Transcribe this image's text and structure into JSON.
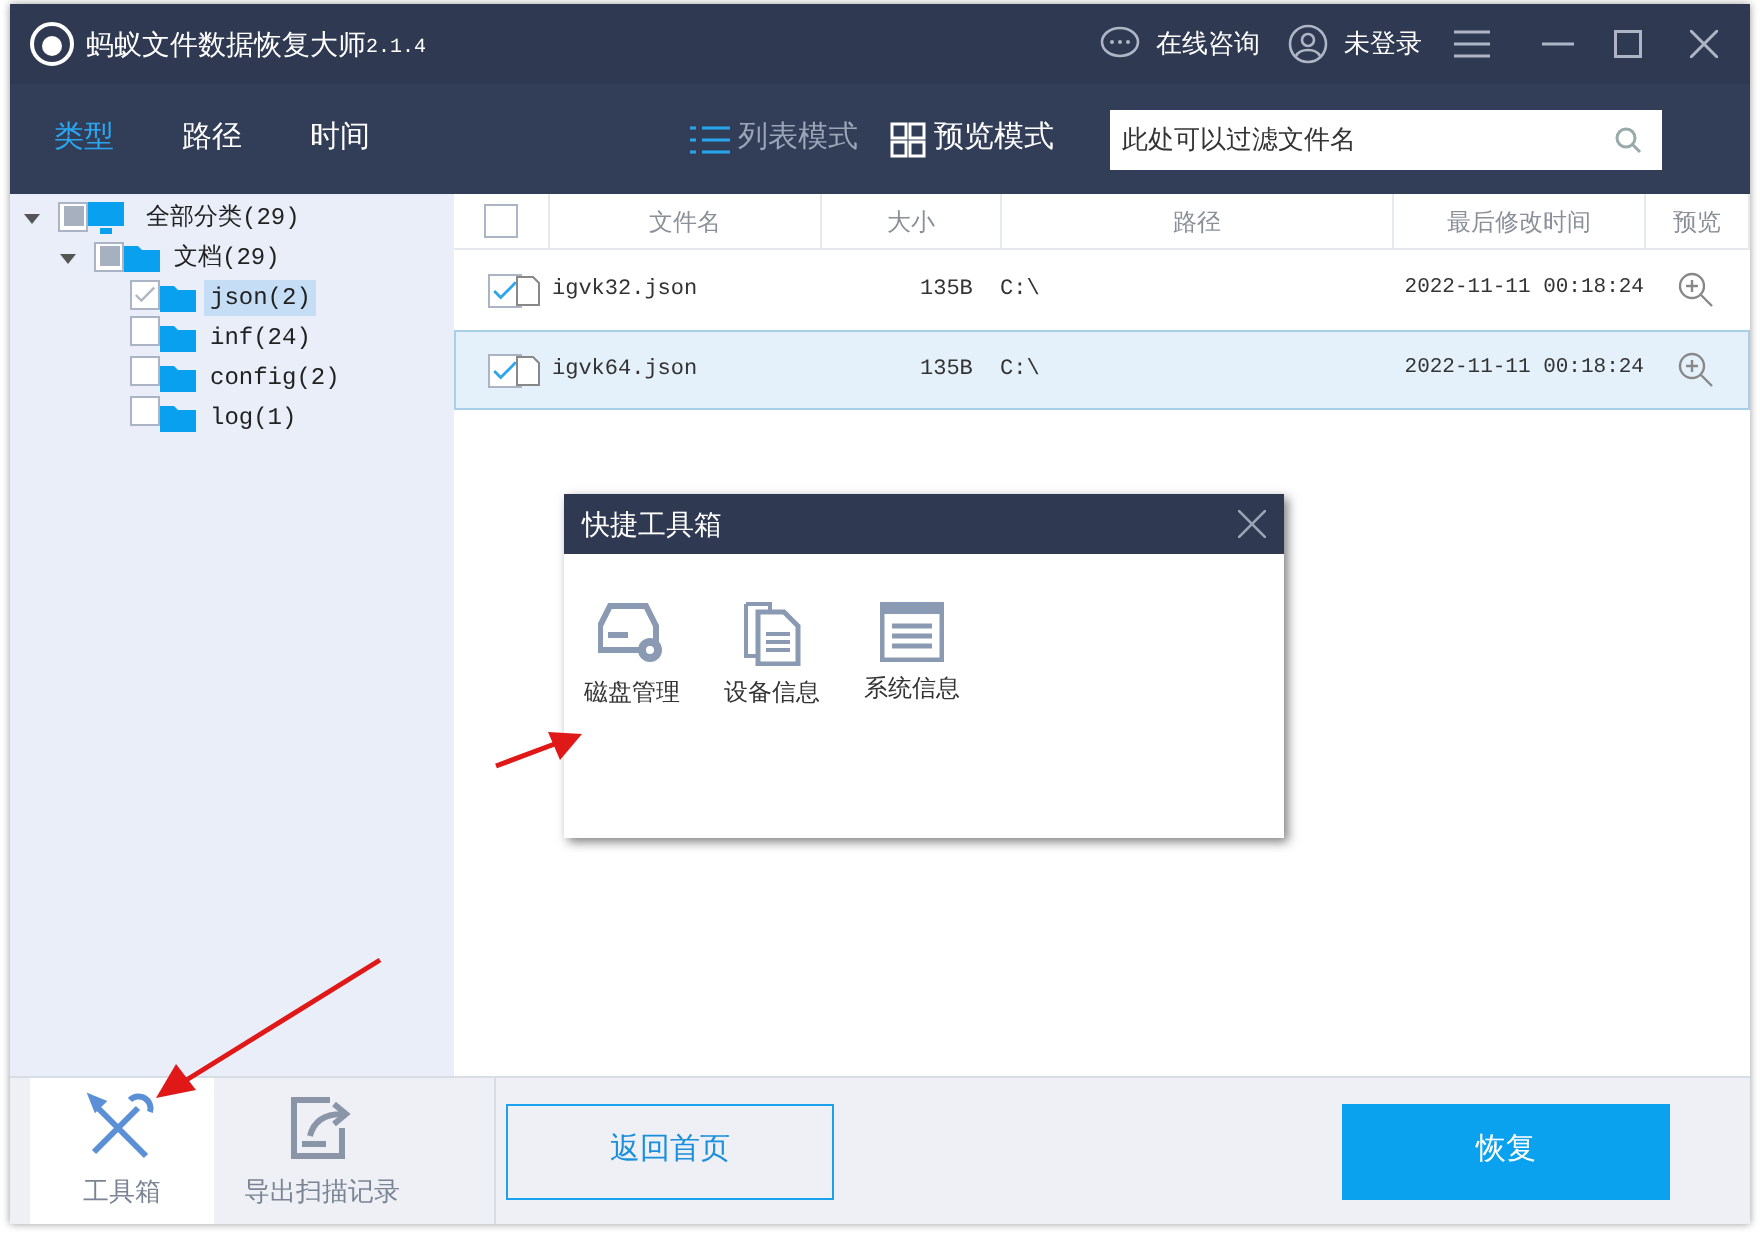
{
  "window": {
    "title": "蚂蚁文件数据恢复大师",
    "version": "2.1.4",
    "consult": "在线咨询",
    "login": "未登录"
  },
  "tabs": [
    {
      "label": "类型",
      "selected": true
    },
    {
      "label": "路径",
      "selected": false
    },
    {
      "label": "时间",
      "selected": false
    }
  ],
  "view_modes": [
    {
      "label": "列表模式",
      "selected": true
    },
    {
      "label": "预览模式",
      "selected": false
    }
  ],
  "search": {
    "placeholder": "此处可以过滤文件名"
  },
  "tree": [
    {
      "label": "全部分类(29)",
      "checked": false,
      "partial": true,
      "expanded": true,
      "selected": false,
      "kind": "computer",
      "children": [
        {
          "label": "文档(29)",
          "checked": false,
          "partial": true,
          "expanded": true,
          "selected": false,
          "kind": "folder",
          "children": [
            {
              "label": "json(2)",
              "checked": true,
              "partial": false,
              "selected": true,
              "kind": "folder"
            },
            {
              "label": "inf(24)",
              "checked": false,
              "partial": false,
              "selected": false,
              "kind": "folder"
            },
            {
              "label": "config(2)",
              "checked": false,
              "partial": false,
              "selected": false,
              "kind": "folder"
            },
            {
              "label": "log(1)",
              "checked": false,
              "partial": false,
              "selected": false,
              "kind": "folder"
            }
          ]
        }
      ]
    }
  ],
  "table": {
    "all_checked": false,
    "columns": [
      "文件名",
      "大小",
      "路径",
      "最后修改时间",
      "预览"
    ],
    "rows": [
      {
        "checked": true,
        "selected": false,
        "name": "igvk32.json",
        "size": "135B",
        "path": "C:\\",
        "modified": "2022-11-11 00:18:24"
      },
      {
        "checked": true,
        "selected": true,
        "name": "igvk64.json",
        "size": "135B",
        "path": "C:\\",
        "modified": "2022-11-11 00:18:24"
      }
    ]
  },
  "dialog": {
    "title": "快捷工具箱",
    "tools": [
      {
        "label": "磁盘管理",
        "kind": "disk"
      },
      {
        "label": "设备信息",
        "kind": "device"
      },
      {
        "label": "系统信息",
        "kind": "system"
      }
    ]
  },
  "bottom": {
    "tools": [
      {
        "label": "工具箱",
        "kind": "toolbox",
        "selected": true
      },
      {
        "label": "导出扫描记录",
        "kind": "export",
        "selected": false
      }
    ],
    "home": "返回首页",
    "recover": "恢复"
  }
}
